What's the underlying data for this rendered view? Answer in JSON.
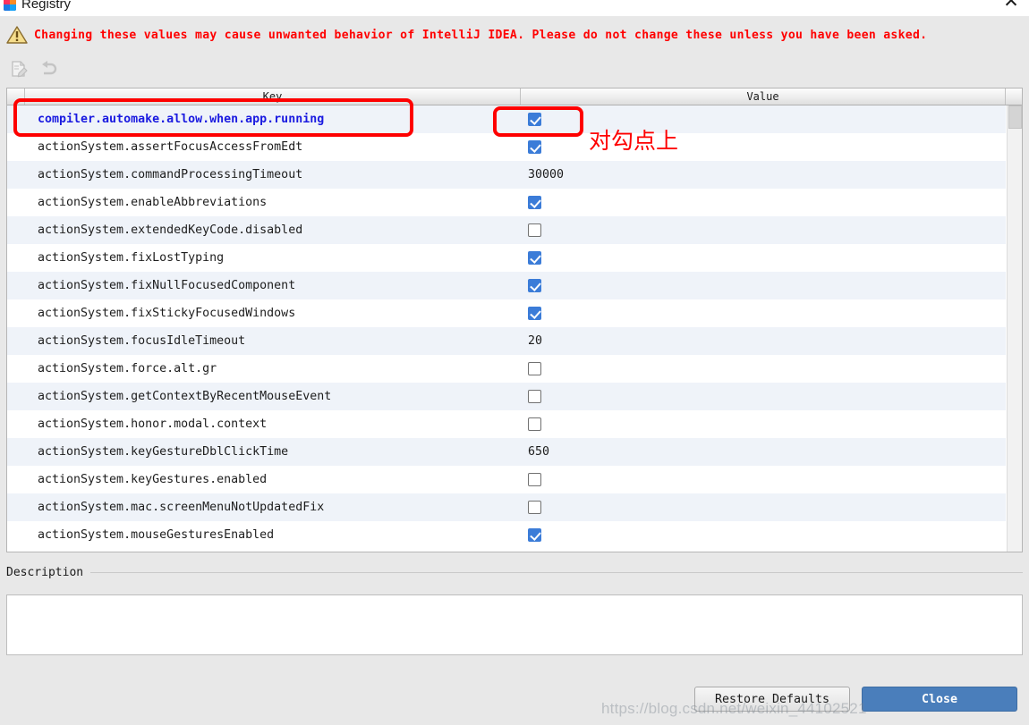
{
  "window": {
    "title": "Registry",
    "app_icon": "intellij-idea-icon",
    "close_label": "✕"
  },
  "warning": {
    "icon": "warning-triangle-icon",
    "text": "Changing these values may cause unwanted behavior of IntelliJ IDEA. Please do not change these unless you have been asked.",
    "color": "#ff0000"
  },
  "toolbar": {
    "buttons": [
      {
        "name": "edit-value-icon",
        "enabled": false
      },
      {
        "name": "revert-to-default-icon",
        "enabled": false
      }
    ]
  },
  "table": {
    "columns": {
      "key": "Key",
      "value": "Value"
    },
    "rows": [
      {
        "key": "compiler.automake.allow.when.app.running",
        "type": "checkbox",
        "checked": true,
        "value": "",
        "selected": true
      },
      {
        "key": "actionSystem.assertFocusAccessFromEdt",
        "type": "checkbox",
        "checked": true,
        "value": "",
        "selected": false
      },
      {
        "key": "actionSystem.commandProcessingTimeout",
        "type": "text",
        "checked": false,
        "value": "30000",
        "selected": false
      },
      {
        "key": "actionSystem.enableAbbreviations",
        "type": "checkbox",
        "checked": true,
        "value": "",
        "selected": false
      },
      {
        "key": "actionSystem.extendedKeyCode.disabled",
        "type": "checkbox",
        "checked": false,
        "value": "",
        "selected": false
      },
      {
        "key": "actionSystem.fixLostTyping",
        "type": "checkbox",
        "checked": true,
        "value": "",
        "selected": false
      },
      {
        "key": "actionSystem.fixNullFocusedComponent",
        "type": "checkbox",
        "checked": true,
        "value": "",
        "selected": false
      },
      {
        "key": "actionSystem.fixStickyFocusedWindows",
        "type": "checkbox",
        "checked": true,
        "value": "",
        "selected": false
      },
      {
        "key": "actionSystem.focusIdleTimeout",
        "type": "text",
        "checked": false,
        "value": "20",
        "selected": false
      },
      {
        "key": "actionSystem.force.alt.gr",
        "type": "checkbox",
        "checked": false,
        "value": "",
        "selected": false
      },
      {
        "key": "actionSystem.getContextByRecentMouseEvent",
        "type": "checkbox",
        "checked": false,
        "value": "",
        "selected": false
      },
      {
        "key": "actionSystem.honor.modal.context",
        "type": "checkbox",
        "checked": false,
        "value": "",
        "selected": false
      },
      {
        "key": "actionSystem.keyGestureDblClickTime",
        "type": "text",
        "checked": false,
        "value": "650",
        "selected": false
      },
      {
        "key": "actionSystem.keyGestures.enabled",
        "type": "checkbox",
        "checked": false,
        "value": "",
        "selected": false
      },
      {
        "key": "actionSystem.mac.screenMenuNotUpdatedFix",
        "type": "checkbox",
        "checked": false,
        "value": "",
        "selected": false
      },
      {
        "key": "actionSystem.mouseGesturesEnabled",
        "type": "checkbox",
        "checked": true,
        "value": "",
        "selected": false
      }
    ]
  },
  "description": {
    "label": "Description",
    "value": ""
  },
  "footer": {
    "restore_defaults_label": "Restore Defaults",
    "close_label": "Close"
  },
  "annotations": {
    "chinese_note": "对勾点上",
    "highlight_color": "#fe0000"
  },
  "watermark": {
    "text": "https://blog.csdn.net/weixin_44102521"
  }
}
